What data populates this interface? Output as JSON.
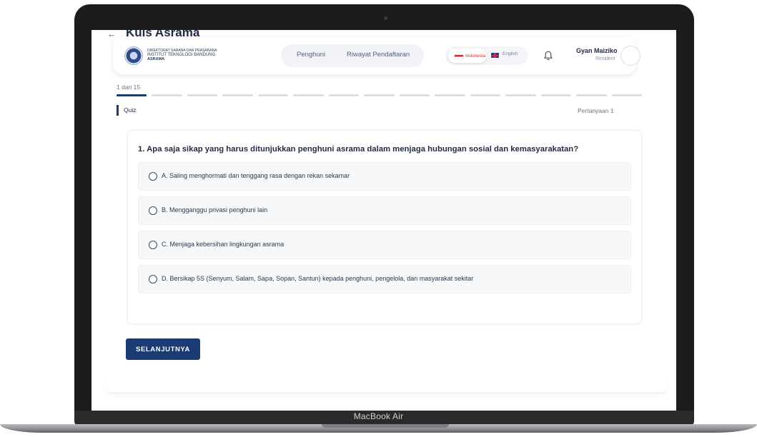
{
  "device": {
    "brand_label": "MacBook Air"
  },
  "page": {
    "title": "Kuis Asrama"
  },
  "header": {
    "org_lines": [
      "DIREKTORAT SARANA DAN PRASARANA",
      "INSTITUT TEKNOLOGI BANDUNG",
      "ASRAMA"
    ],
    "nav_items": [
      "Penghuni",
      "Riwayat Pendaftaran"
    ],
    "languages": [
      {
        "label": "Indonesia",
        "active": true,
        "color": "#e2232f"
      },
      {
        "label": "English",
        "active": false
      }
    ],
    "user": {
      "name": "Gyan Maiziko",
      "role": "Resident"
    }
  },
  "progress": {
    "label": "1 dari 15",
    "current": 1,
    "total": 15
  },
  "section": {
    "tag": "Quiz",
    "counter": "Pertanyaan 1"
  },
  "question": {
    "text": "1. Apa saja sikap yang harus ditunjukkan penghuni asrama dalam menjaga hubungan sosial dan kemasyarakatan?",
    "options": [
      "A. Saling menghormati dan tenggang rasa dengan rekan sekamar",
      "B. Mengganggu privasi penghuni lain",
      "C. Menjaga kebersihan lingkungan asrama",
      "D. Bersikap 5S (Senyum, Salam, Sapa, Sopan, Santun) kepada penghuni, pengelola, dan masyarakat sekitar"
    ]
  },
  "actions": {
    "next_label": "SELANJUTNYA"
  },
  "colors": {
    "primary": "#1b3b73",
    "frame": "#1c1c1e"
  }
}
